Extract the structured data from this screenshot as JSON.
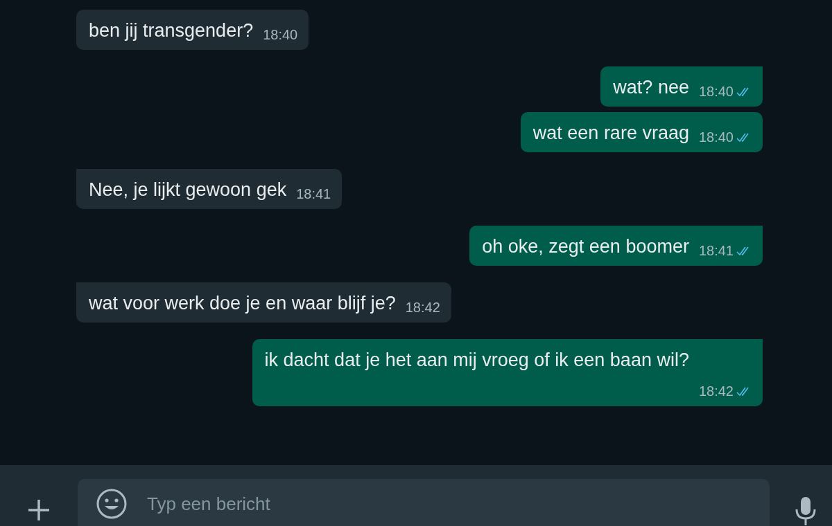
{
  "messages": [
    {
      "kind": "in",
      "tail": false,
      "text": "ben jij transgender?",
      "time": "18:40",
      "time_below": false
    },
    {
      "kind": "out",
      "tail": true,
      "text": "wat? nee",
      "time": "18:40",
      "read": true,
      "time_below": false
    },
    {
      "kind": "out",
      "tail": false,
      "text": "wat een rare vraag",
      "time": "18:40",
      "read": true,
      "time_below": false
    },
    {
      "kind": "in",
      "tail": true,
      "text": "Nee, je lijkt gewoon gek",
      "time": "18:41",
      "time_below": false
    },
    {
      "kind": "out",
      "tail": true,
      "text": "oh oke, zegt een boomer",
      "time": "18:41",
      "read": true,
      "time_below": false
    },
    {
      "kind": "in",
      "tail": true,
      "text": "wat voor werk doe je en waar blijf je?",
      "time": "18:42",
      "time_below": false
    },
    {
      "kind": "out",
      "tail": true,
      "text": "ik dacht dat je het aan mij vroeg of ik een baan wil?",
      "time": "18:42",
      "read": true,
      "time_below": true
    }
  ],
  "composer": {
    "placeholder": "Typ een bericht"
  }
}
